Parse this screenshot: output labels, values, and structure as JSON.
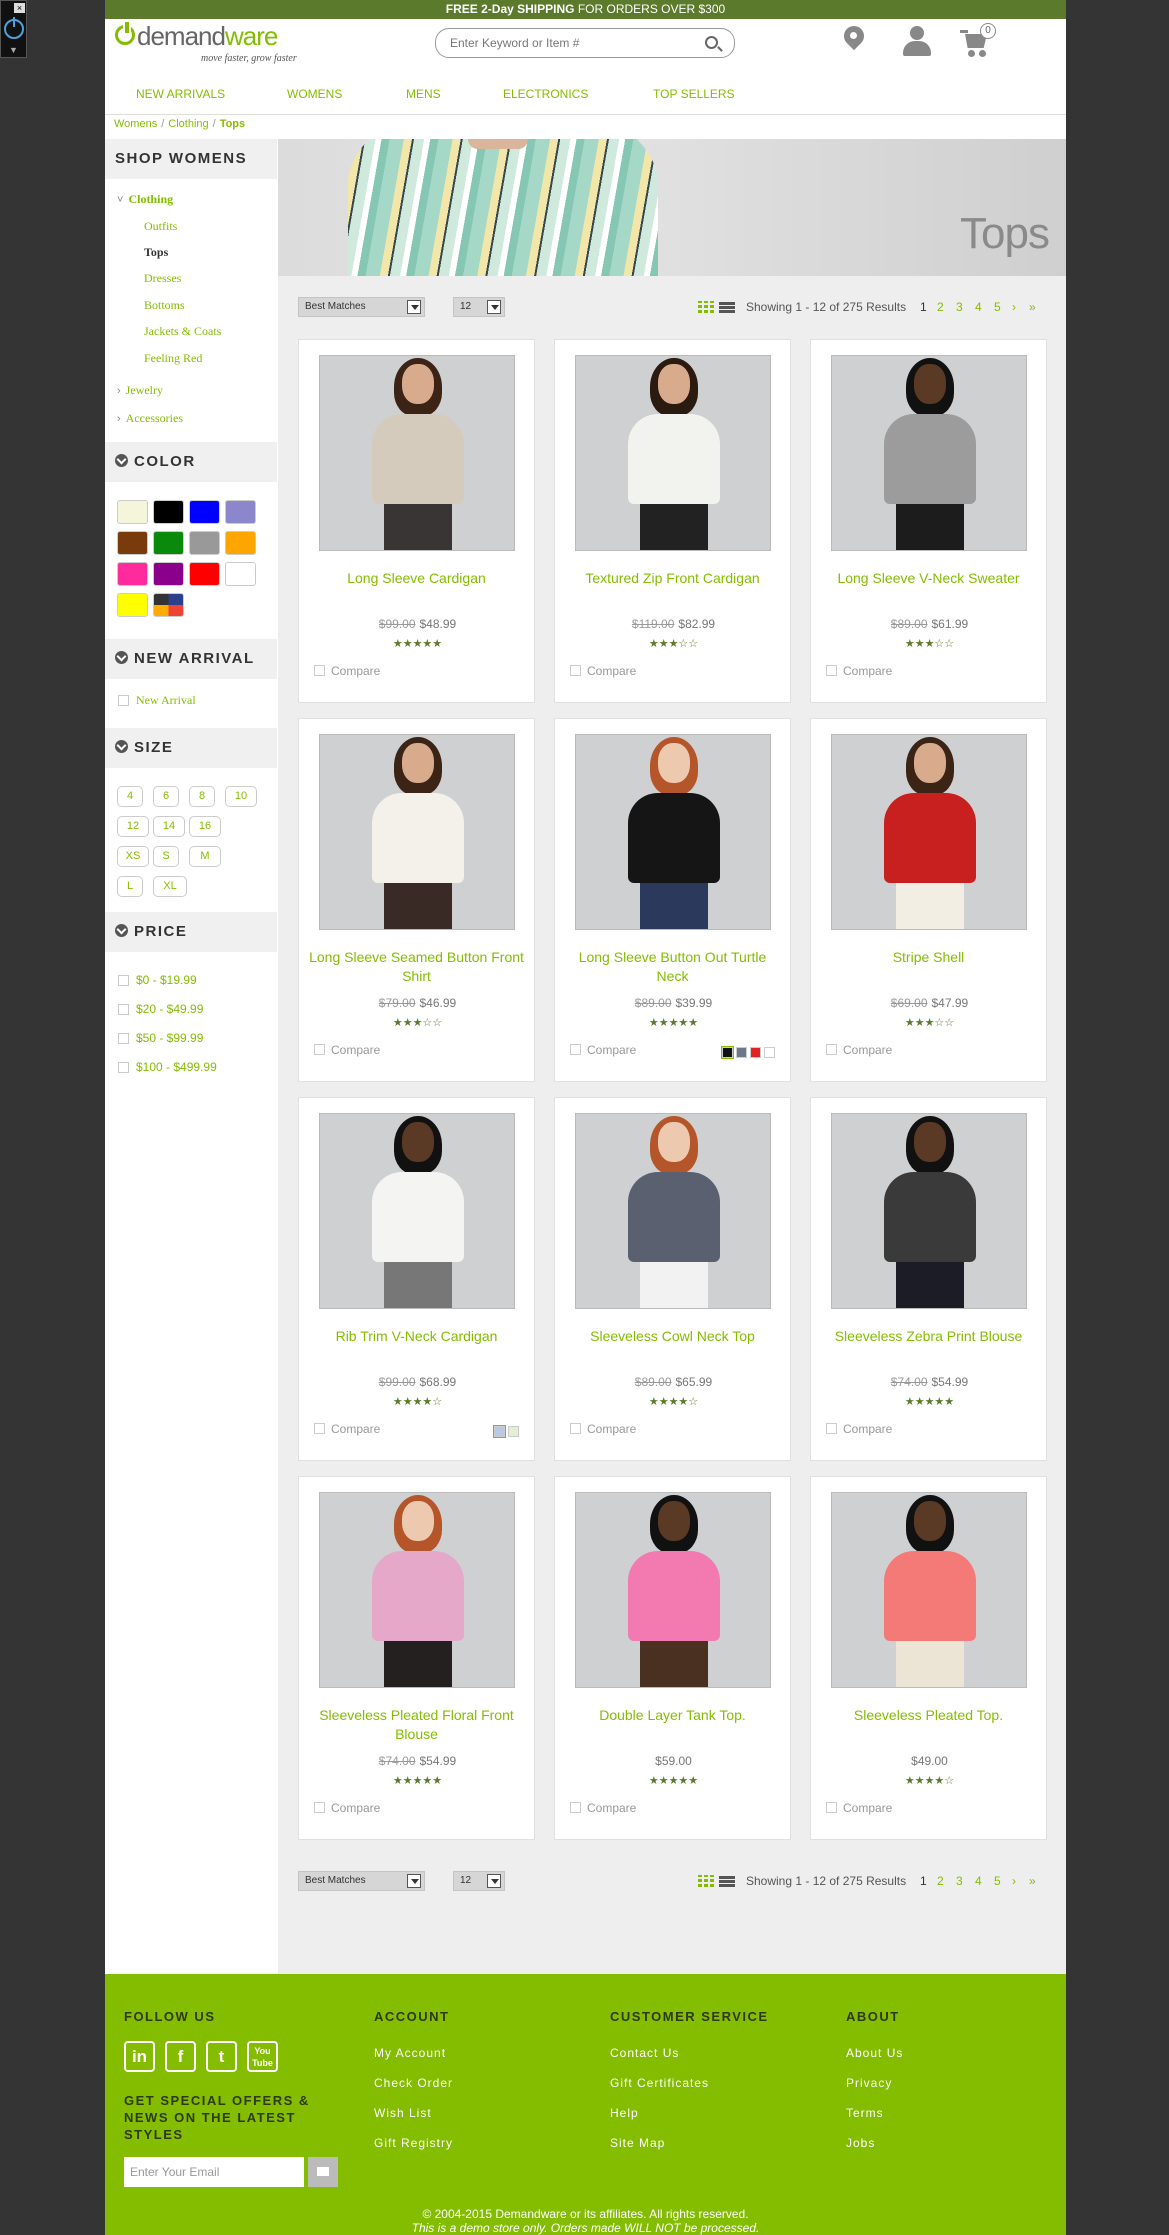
{
  "promo": {
    "bold": "FREE 2-Day SHIPPING",
    "rest": " FOR ORDERS OVER $300"
  },
  "logo": {
    "word_a": "demand",
    "word_b": "ware",
    "tagline": "move faster, grow faster"
  },
  "search": {
    "placeholder": "Enter Keyword or Item #"
  },
  "cart": {
    "count": "0"
  },
  "nav": [
    "NEW ARRIVALS",
    "WOMENS",
    "MENS",
    "ELECTRONICS",
    "TOP SELLERS"
  ],
  "breadcrumb": [
    "Womens",
    "Clothing",
    "Tops"
  ],
  "sidebar": {
    "heading": "SHOP WOMENS",
    "clothing": "Clothing",
    "subcats": [
      "Outfits",
      "Tops",
      "Dresses",
      "Bottoms",
      "Jackets & Coats",
      "Feeling Red"
    ],
    "jewelry": "Jewelry",
    "accessories": "Accessories",
    "color_heading": "COLOR",
    "colors": [
      "#f5f5dc",
      "#000000",
      "#0000ff",
      "#8c87cc",
      "#7a3b0c",
      "#0a8a0a",
      "#999999",
      "#ffa500",
      "#ff2b9c",
      "#8a008a",
      "#ff0000",
      "#ffffff",
      "#ffff00",
      "miscellaneous"
    ],
    "new_arrival_heading": "NEW ARRIVAL",
    "new_arrival_option": "New Arrival",
    "size_heading": "SIZE",
    "sizes": [
      "4",
      "6",
      "8",
      "10",
      "12",
      "14",
      "16",
      "XS",
      "S",
      "M",
      "L",
      "XL"
    ],
    "price_heading": "PRICE",
    "prices": [
      "$0 - $19.99",
      "$20 - $49.99",
      "$50 - $99.99",
      "$100 - $499.99"
    ]
  },
  "banner": {
    "title": "Tops"
  },
  "toolbar": {
    "sort": "Best Matches",
    "page_size": "12",
    "showing": "Showing 1 - 12 of 275 Results",
    "pages": [
      "1",
      "2",
      "3",
      "4",
      "5",
      "›",
      "»"
    ]
  },
  "compare_label": "Compare",
  "products": [
    {
      "name": "Long Sleeve Cardigan",
      "orig": "$99.00",
      "price": "$48.99",
      "rating": 4.5,
      "top": "#d4cbbd",
      "bottom": "#3a3535",
      "hair": "#3b2416",
      "skin": "#d8ab8c"
    },
    {
      "name": "Textured Zip Front Cardigan",
      "orig": "$119.00",
      "price": "$82.99",
      "rating": 2.5,
      "top": "#f2f2ee",
      "bottom": "#222222",
      "hair": "#2a1a10",
      "skin": "#d8ab8c"
    },
    {
      "name": "Long Sleeve V-Neck Sweater",
      "orig": "$89.00",
      "price": "$61.99",
      "rating": 2.5,
      "top": "#9c9c9c",
      "bottom": "#1c1c1c",
      "hair": "#111111",
      "skin": "#5a3a24"
    },
    {
      "name": "Long Sleeve Seamed Button Front Shirt",
      "orig": "$79.00",
      "price": "$46.99",
      "rating": 2.5,
      "top": "#f4f1ea",
      "bottom": "#3a2a25",
      "hair": "#3b2416",
      "skin": "#d8ab8c"
    },
    {
      "name": "Long Sleeve Button Out Turtle Neck",
      "orig": "$89.00",
      "price": "$39.99",
      "rating": 4.5,
      "top": "#151515",
      "bottom": "#2b3a5c",
      "hair": "#b5552a",
      "skin": "#edc9b0",
      "chips": [
        "#111111",
        "#6a7a8a",
        "#e52222",
        "#ffffff"
      ]
    },
    {
      "name": "Stripe Shell",
      "orig": "$69.00",
      "price": "$47.99",
      "rating": 2.5,
      "top": "#c8201f",
      "bottom": "#f2eee4",
      "hair": "#3b2416",
      "skin": "#d8ab8c"
    },
    {
      "name": "Rib Trim V-Neck Cardigan",
      "orig": "$99.00",
      "price": "$68.99",
      "rating": 3.5,
      "top": "#f4f4f2",
      "bottom": "#777777",
      "hair": "#111111",
      "skin": "#5a3a24",
      "chips": [
        "#b8c8e6",
        "#e6eed2"
      ]
    },
    {
      "name": "Sleeveless Cowl Neck Top",
      "orig": "$89.00",
      "price": "$65.99",
      "rating": 4,
      "top": "#5a6070",
      "bottom": "#f2f2f2",
      "hair": "#b5552a",
      "skin": "#edc9b0"
    },
    {
      "name": "Sleeveless Zebra Print Blouse",
      "orig": "$74.00",
      "price": "$54.99",
      "rating": 4.5,
      "top": "#3a3a3a",
      "bottom": "#1c1c26",
      "hair": "#111111",
      "skin": "#5a3a24"
    },
    {
      "name": "Sleeveless Pleated Floral Front Blouse",
      "orig": "$74.00",
      "price": "$54.99",
      "rating": 4.5,
      "top": "#e6a8c8",
      "bottom": "#252020",
      "hair": "#b5552a",
      "skin": "#edc9b0"
    },
    {
      "name": "Double Layer Tank Top.",
      "orig": "",
      "price": "$59.00",
      "rating": 4.5,
      "top": "#f27ab0",
      "bottom": "#4a3020",
      "hair": "#111111",
      "skin": "#5a3a24"
    },
    {
      "name": "Sleeveless Pleated Top.",
      "orig": "",
      "price": "$49.00",
      "rating": 3.5,
      "top": "#f47a78",
      "bottom": "#ece4d4",
      "hair": "#111111",
      "skin": "#5a3a24"
    }
  ],
  "footer": {
    "follow": "FOLLOW US",
    "social": [
      "in",
      "f",
      "t",
      "You Tube"
    ],
    "offers": "GET SPECIAL OFFERS & NEWS ON THE LATEST STYLES",
    "email_placeholder": "Enter Your Email",
    "account_heading": "ACCOUNT",
    "account_links": [
      "My Account",
      "Check Order",
      "Wish List",
      "Gift Registry"
    ],
    "service_heading": "CUSTOMER SERVICE",
    "service_links": [
      "Contact Us",
      "Gift Certificates",
      "Help",
      "Site Map"
    ],
    "about_heading": "ABOUT",
    "about_links": [
      "About Us",
      "Privacy",
      "Terms",
      "Jobs"
    ],
    "copyright": "© 2004-2015 Demandware or its affiliates. All rights reserved.",
    "disclaimer": "This is a demo store only. Orders made WILL NOT be processed."
  }
}
